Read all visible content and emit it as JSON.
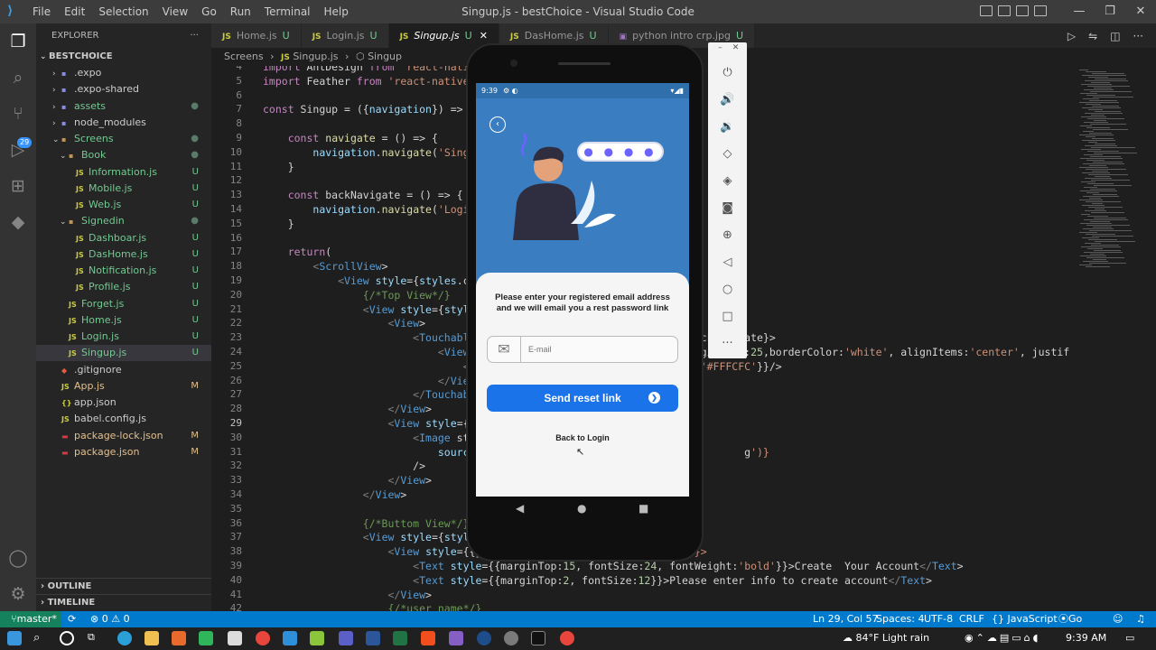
{
  "window": {
    "title": "Singup.js - bestChoice - Visual Studio Code",
    "menu": [
      "File",
      "Edit",
      "Selection",
      "View",
      "Go",
      "Run",
      "Terminal",
      "Help"
    ]
  },
  "activity": {
    "scm_badge": "29"
  },
  "explorer": {
    "header": "EXPLORER",
    "root": "BESTCHOICE",
    "items": [
      {
        "label": ".expo",
        "kind": "folder",
        "status": ""
      },
      {
        "label": ".expo-shared",
        "kind": "folder",
        "status": ""
      },
      {
        "label": "assets",
        "kind": "folder",
        "status": "●"
      },
      {
        "label": "node_modules",
        "kind": "folder",
        "status": ""
      },
      {
        "label": "Screens",
        "kind": "folder-open",
        "status": "●"
      },
      {
        "label": "Book",
        "kind": "folder-open",
        "status": "●"
      },
      {
        "label": "Information.js",
        "kind": "js",
        "status": "U"
      },
      {
        "label": "Mobile.js",
        "kind": "js",
        "status": "U"
      },
      {
        "label": "Web.js",
        "kind": "js",
        "status": "U"
      },
      {
        "label": "Signedin",
        "kind": "folder-open",
        "status": "●"
      },
      {
        "label": "Dashboar.js",
        "kind": "js",
        "status": "U"
      },
      {
        "label": "DasHome.js",
        "kind": "js",
        "status": "U"
      },
      {
        "label": "Notification.js",
        "kind": "js",
        "status": "U"
      },
      {
        "label": "Profile.js",
        "kind": "js",
        "status": "U"
      },
      {
        "label": "Forget.js",
        "kind": "js",
        "status": "U"
      },
      {
        "label": "Home.js",
        "kind": "js",
        "status": "U"
      },
      {
        "label": "Login.js",
        "kind": "js",
        "status": "U"
      },
      {
        "label": "Singup.js",
        "kind": "js",
        "status": "U"
      },
      {
        "label": ".gitignore",
        "kind": "git",
        "status": ""
      },
      {
        "label": "App.js",
        "kind": "js",
        "status": "M"
      },
      {
        "label": "app.json",
        "kind": "json",
        "status": ""
      },
      {
        "label": "babel.config.js",
        "kind": "js",
        "status": ""
      },
      {
        "label": "package-lock.json",
        "kind": "npm",
        "status": "M"
      },
      {
        "label": "package.json",
        "kind": "npm",
        "status": "M"
      }
    ],
    "outline": "OUTLINE",
    "timeline": "TIMELINE"
  },
  "tabs": [
    {
      "label": "Home.js",
      "status": "U",
      "active": false
    },
    {
      "label": "Login.js",
      "status": "U",
      "active": false
    },
    {
      "label": "Singup.js",
      "status": "U",
      "active": true
    },
    {
      "label": "DasHome.js",
      "status": "U",
      "active": false
    },
    {
      "label": "python intro crp.jpg",
      "status": "U",
      "active": false
    }
  ],
  "breadcrumb": {
    "folder": "Screens",
    "file": "Singup.js",
    "symbol": "Singup"
  },
  "code": [
    {
      "n": "4",
      "t": "import AntDesign from 'react-native"
    },
    {
      "n": "5",
      "t": "import Feather from 'react-native-v"
    },
    {
      "n": "6",
      "t": ""
    },
    {
      "n": "7",
      "t": "const Singup = ({navigation}) => {"
    },
    {
      "n": "8",
      "t": ""
    },
    {
      "n": "9",
      "t": "    const navigate = () => {"
    },
    {
      "n": "10",
      "t": "        navigation.navigate('Singup"
    },
    {
      "n": "11",
      "t": "    }"
    },
    {
      "n": "12",
      "t": ""
    },
    {
      "n": "13",
      "t": "    const backNavigate = () => {"
    },
    {
      "n": "14",
      "t": "        navigation.navigate('Login'"
    },
    {
      "n": "15",
      "t": "    }"
    },
    {
      "n": "16",
      "t": ""
    },
    {
      "n": "17",
      "t": "    return("
    },
    {
      "n": "18",
      "t": "        <ScrollView>"
    },
    {
      "n": "19",
      "t": "            <View style={styles.con"
    },
    {
      "n": "20",
      "t": "                {/*Top View*/}"
    },
    {
      "n": "21",
      "t": "                <View style={styles"
    },
    {
      "n": "22",
      "t": "                    <View>"
    },
    {
      "n": "23",
      "t": "                        <TouchableO                                  ackNavigate}>"
    },
    {
      "n": "24",
      "t": "                            <View s                               ,marginLeft:25,borderColor:'white', alignItems:'center', justif"
    },
    {
      "n": "25",
      "t": "                                <An                                or:'#FFFCFC'}}/>"
    },
    {
      "n": "26",
      "t": "                            </View>"
    },
    {
      "n": "27",
      "t": "                        </Touchable"
    },
    {
      "n": "28",
      "t": "                    </View>"
    },
    {
      "n": "29",
      "t": "                    <View style={{a"
    },
    {
      "n": "30",
      "t": "                        <Image styl"
    },
    {
      "n": "31",
      "t": "                            source=                                          g')}"
    },
    {
      "n": "32",
      "t": "                        />"
    },
    {
      "n": "33",
      "t": "                    </View>"
    },
    {
      "n": "34",
      "t": "                </View>"
    },
    {
      "n": "35",
      "t": ""
    },
    {
      "n": "36",
      "t": "                {/*Buttom View*/}"
    },
    {
      "n": "37",
      "t": "                <View style={styles"
    },
    {
      "n": "38",
      "t": "                    <View style={{ju                            ter'}}>"
    },
    {
      "n": "39",
      "t": "                        <Text style={{marginTop:15, fontSize:24, fontWeight:'bold'}}>Create  Your Account</Text>"
    },
    {
      "n": "40",
      "t": "                        <Text style={{marginTop:2, fontSize:12}}>Please enter info to create account</Text>"
    },
    {
      "n": "41",
      "t": "                    </View>"
    },
    {
      "n": "42",
      "t": "                    {/*user name*/}"
    }
  ],
  "phone": {
    "time": "9:39",
    "password_dots": "● ● ● ●",
    "message": "Please enter your registered email address and we will email you a rest password link",
    "email_placeholder": "E-mail",
    "send_label": "Send reset link",
    "back_label": "Back to Login"
  },
  "statusbar": {
    "branch": "master*",
    "problems": "⊗ 0 ⚠ 0",
    "position": "Ln 29, Col 57",
    "spaces": "Spaces: 4",
    "encoding": "UTF-8",
    "eol": "CRLF",
    "language": "{} JavaScript",
    "golive": "Go Live"
  },
  "taskbar": {
    "weather": "84°F  Light rain",
    "time": "9:39 AM"
  },
  "colors": {
    "accent": "#007acc",
    "button": "#1a73e8",
    "phone_bg": "#3a7ec1"
  }
}
